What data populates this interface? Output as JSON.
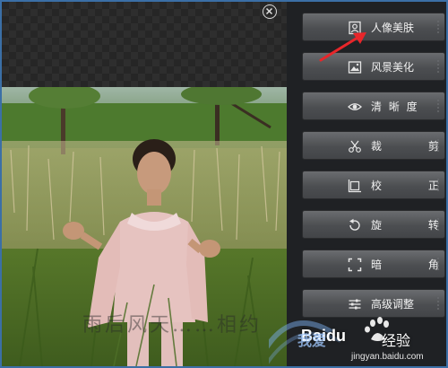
{
  "toolbar": {
    "buttons": [
      {
        "label": "人像美肤",
        "icon": "portrait-icon"
      },
      {
        "label": "风景美化",
        "icon": "landscape-icon"
      },
      {
        "label": "清 晰 度",
        "icon": "eye-icon"
      },
      {
        "label": "裁 剪",
        "icon": "scissors-icon"
      },
      {
        "label": "校 正",
        "icon": "straighten-icon"
      },
      {
        "label": "旋 转",
        "icon": "rotate-icon"
      },
      {
        "label": "暗 角",
        "icon": "vignette-icon"
      },
      {
        "label": "高级调整",
        "icon": "sliders-icon"
      }
    ]
  },
  "canvas": {
    "close_icon": "close-circle-icon"
  },
  "watermark": {
    "photo_text": "雨后风天……相约",
    "brand_text": "Baidu",
    "brand_cn": "经验",
    "url": "jingyan.baidu.com",
    "side_text": "我爱"
  },
  "colors": {
    "frame_border": "#3b6fa6",
    "panel_bg": "#1f2124",
    "arrow": "#e8262a"
  }
}
